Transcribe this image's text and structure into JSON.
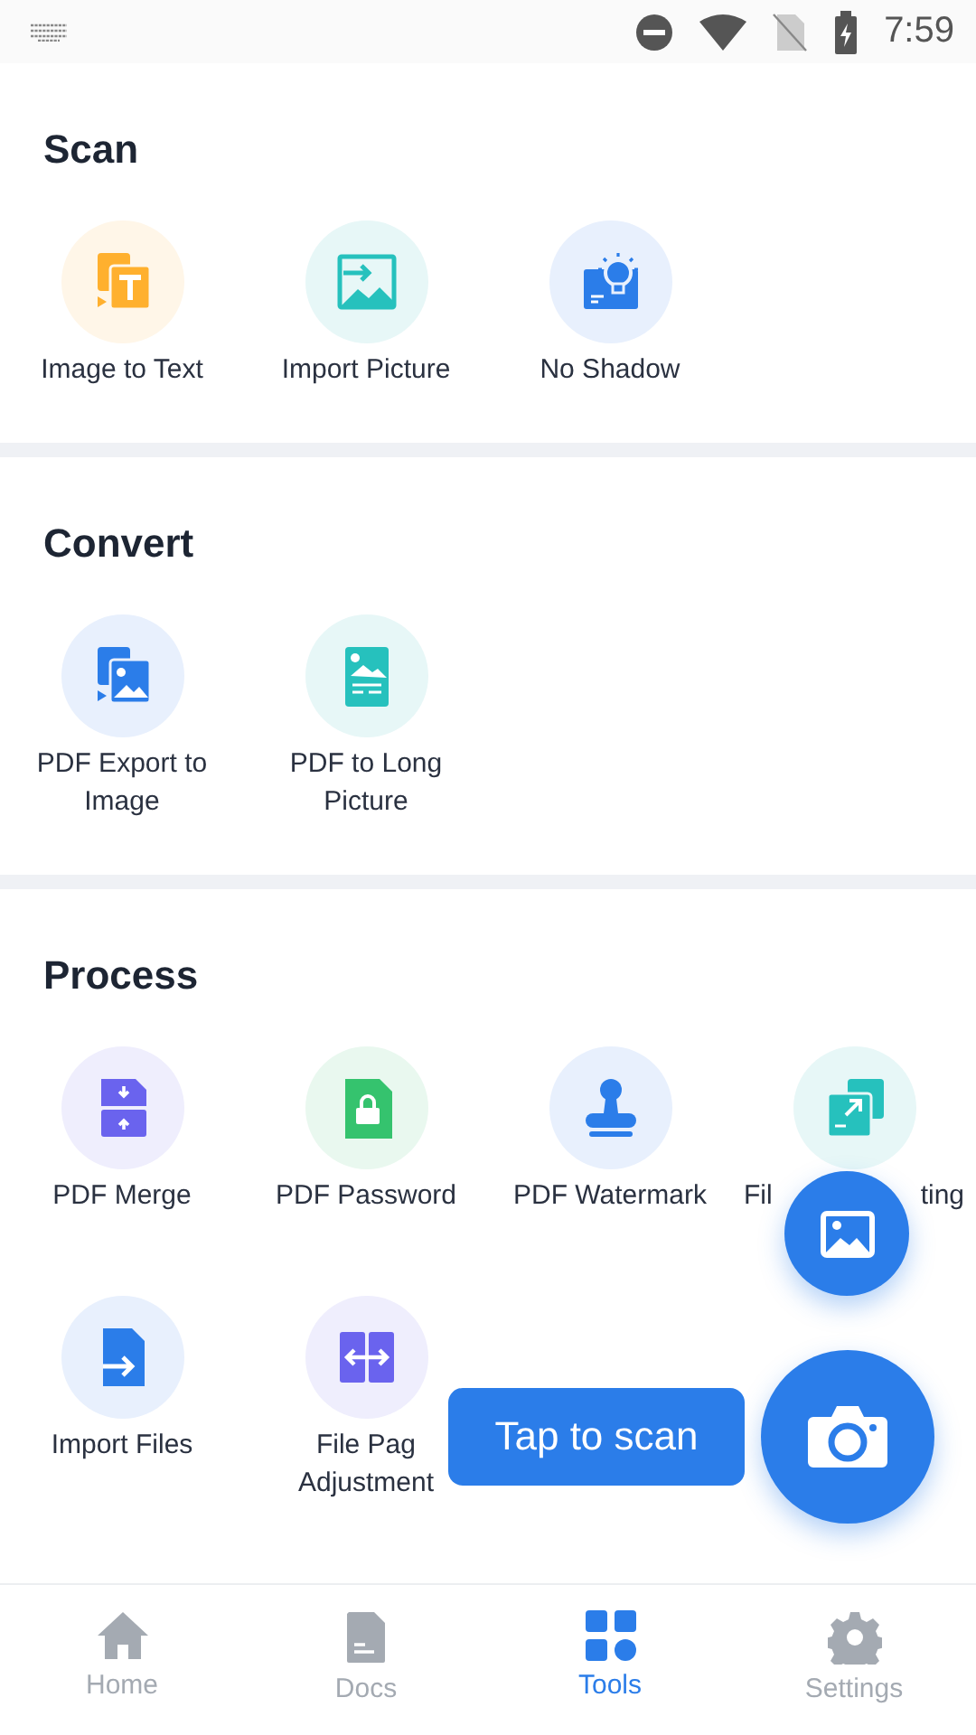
{
  "status_bar": {
    "time": "7:59"
  },
  "sections": [
    {
      "title": "Scan",
      "items": [
        {
          "label": [
            "Image to Text"
          ]
        },
        {
          "label": [
            "Import Picture"
          ]
        },
        {
          "label": [
            "No Shadow"
          ]
        }
      ]
    },
    {
      "title": "Convert",
      "items": [
        {
          "label": [
            "PDF Export to",
            "Image"
          ]
        },
        {
          "label": [
            "PDF to Long",
            "Picture"
          ]
        }
      ]
    },
    {
      "title": "Process",
      "items": [
        {
          "label": [
            "PDF Merge"
          ]
        },
        {
          "label": [
            "PDF Password"
          ]
        },
        {
          "label": [
            "PDF Watermark"
          ]
        },
        {
          "label": [
            "Fil"
          ],
          "label_tail": "ting"
        },
        {
          "label": [
            "Import Files"
          ]
        },
        {
          "label": [
            "File Pag",
            "Adjustment"
          ]
        }
      ]
    }
  ],
  "tooltip": "Tap to scan",
  "bottom_nav": [
    {
      "label": "Home",
      "selected": false
    },
    {
      "label": "Docs",
      "selected": false
    },
    {
      "label": "Tools",
      "selected": true
    },
    {
      "label": "Settings",
      "selected": false
    }
  ]
}
